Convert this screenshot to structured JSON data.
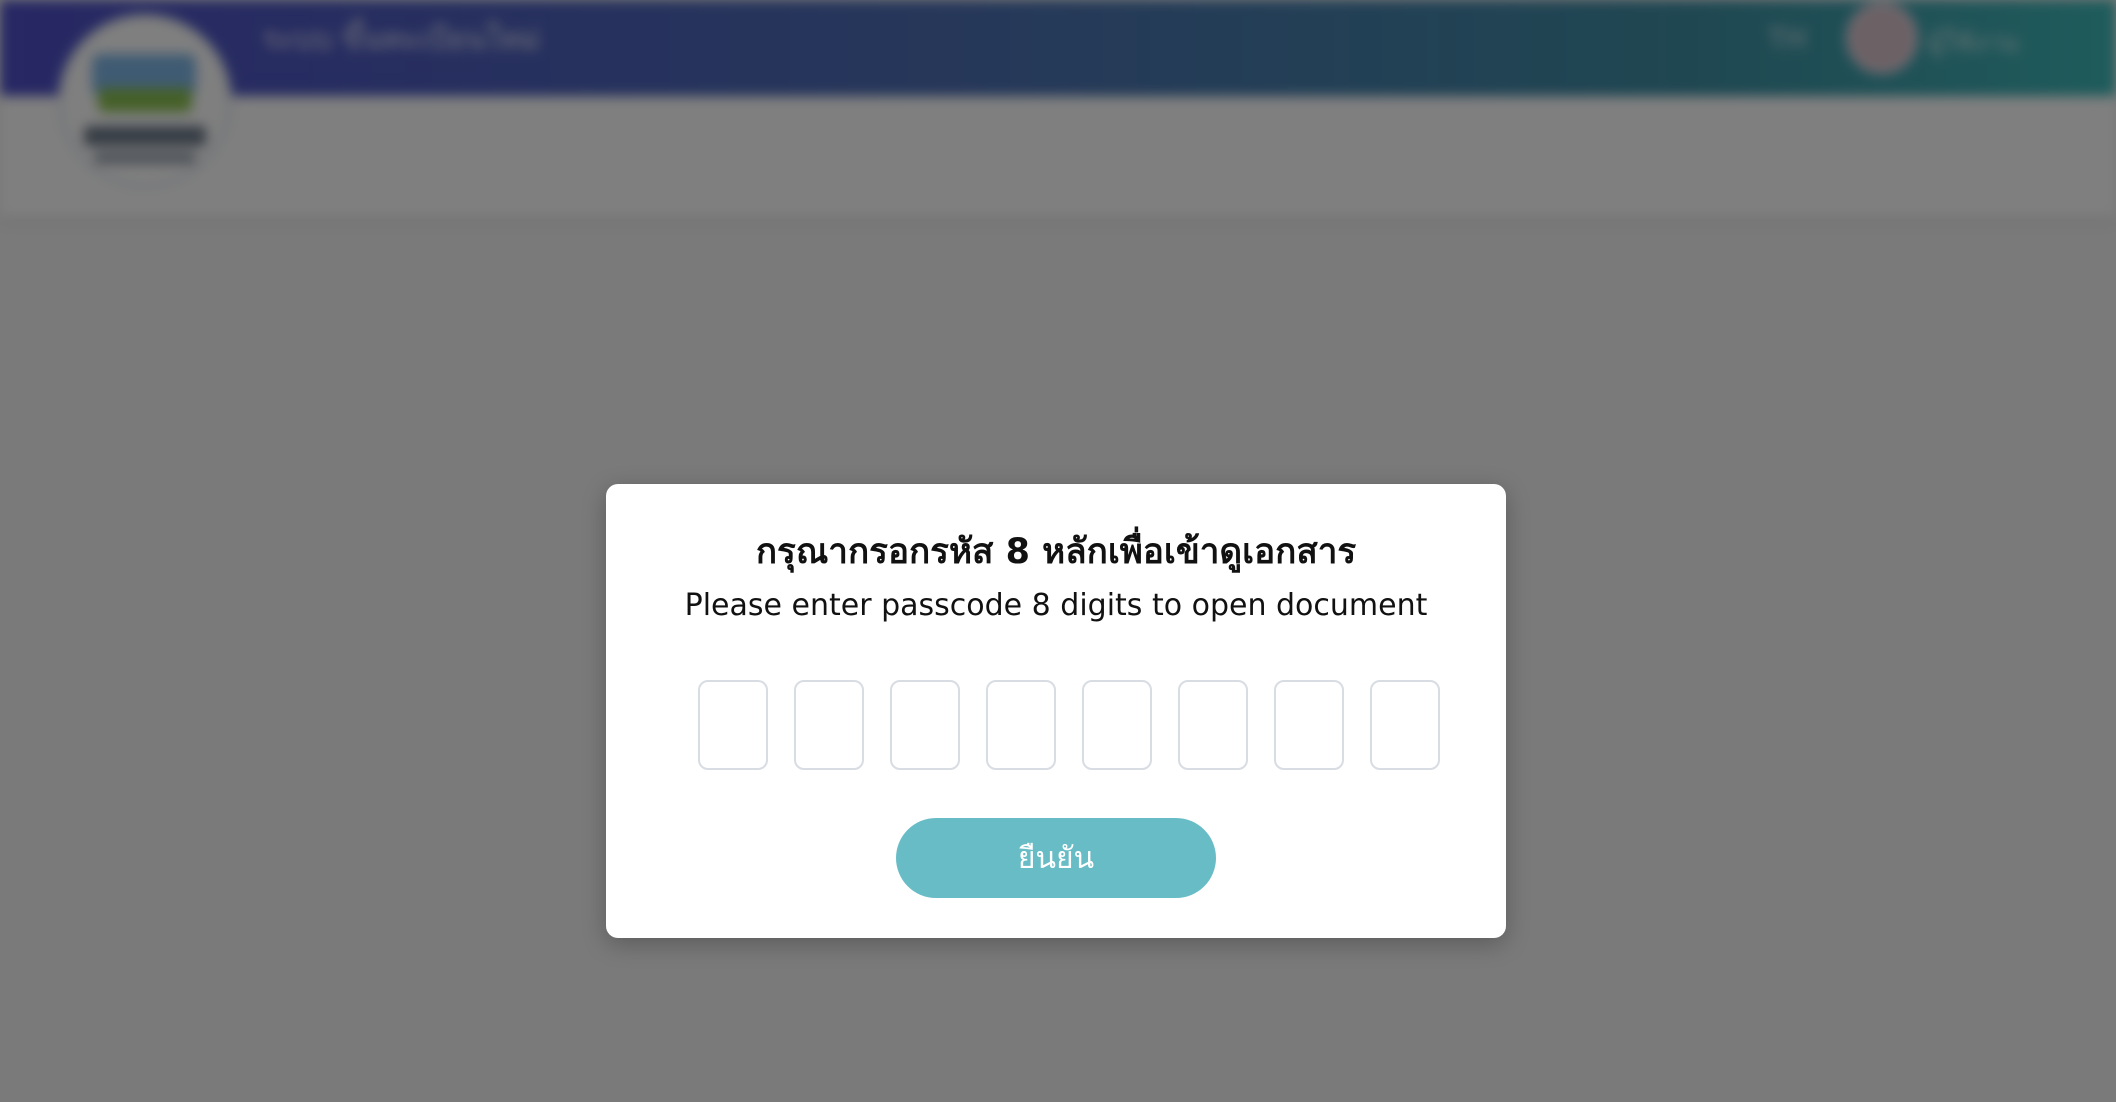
{
  "header": {
    "app_title": "ระบบ ขึ้นทะเบียนใหม่",
    "language": "TH",
    "user_name": "ผู้ใช้งาน"
  },
  "modal": {
    "title_th": "กรุณากรอกรหัส 8 หลักเพื่อเข้าดูเอกสาร",
    "subtitle_en": "Please enter passcode 8 digits to open document",
    "digits": [
      "",
      "",
      "",
      "",
      "",
      "",
      "",
      ""
    ],
    "confirm_label": "ยืนยัน"
  },
  "colors": {
    "confirm_button": "#67bcc6",
    "header_gradient_start": "#4e4fc8",
    "header_gradient_end": "#3fb8b8",
    "overlay": "rgba(0,0,0,0.5)"
  }
}
